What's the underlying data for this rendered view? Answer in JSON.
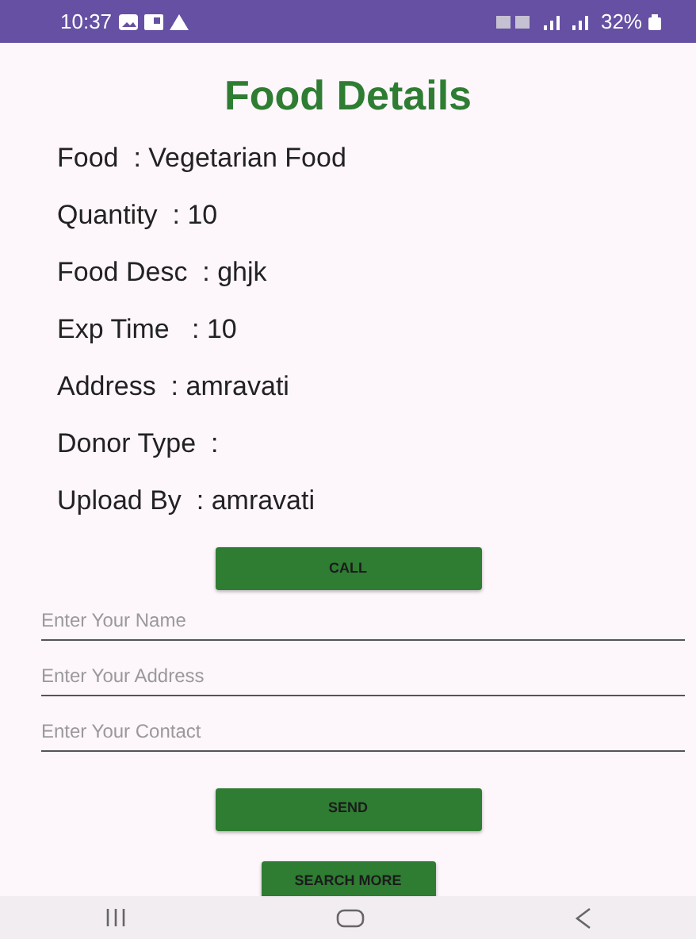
{
  "status_bar": {
    "time": "10:37",
    "battery": "32%"
  },
  "title": "Food Details",
  "details": [
    "Food  : Vegetarian Food",
    "Quantity  : 10",
    "Food Desc  : ghjk",
    "Exp Time   : 10",
    "Address  : amravati",
    "Donor Type  :",
    "Upload By  : amravati"
  ],
  "call_button": "CALL",
  "fields": [
    {
      "placeholder": "Enter Your Name"
    },
    {
      "placeholder": "Enter Your Address"
    },
    {
      "placeholder": "Enter Your Contact"
    }
  ],
  "send_button": "SEND",
  "search_button": "SEARCH MORE"
}
